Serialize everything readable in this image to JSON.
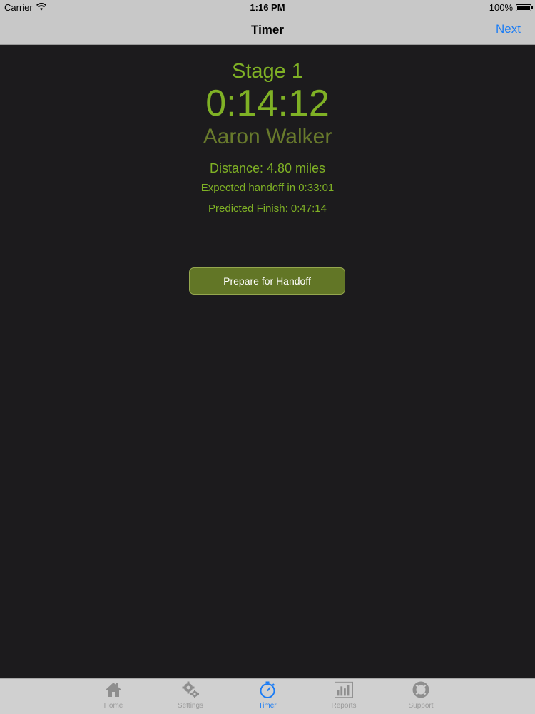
{
  "status_bar": {
    "carrier": "Carrier",
    "time": "1:16 PM",
    "battery_level": "100%",
    "battery_fraction": 1.0
  },
  "nav": {
    "title": "Timer",
    "next_label": "Next"
  },
  "timer": {
    "stage": "Stage 1",
    "elapsed": "0:14:12",
    "runner": "Aaron Walker",
    "distance": "Distance: 4.80 miles",
    "expected_handoff": "Expected handoff in 0:33:01",
    "predicted_finish": "Predicted Finish: 0:47:14"
  },
  "handoff_button": {
    "label": "Prepare for Handoff"
  },
  "tab_bar": {
    "tabs": [
      {
        "label": "Home",
        "icon": "home-icon"
      },
      {
        "label": "Settings",
        "icon": "gear-icon"
      },
      {
        "label": "Timer",
        "icon": "stopwatch-icon",
        "active": true
      },
      {
        "label": "Reports",
        "icon": "bar-chart-icon"
      },
      {
        "label": "Support",
        "icon": "lifebuoy-icon"
      }
    ]
  },
  "colors": {
    "accent_green": "#7fb125",
    "runner_green": "#687a2c",
    "button_green": "#627626",
    "ios_blue": "#1a7cf5",
    "background": "#1c1b1d"
  }
}
